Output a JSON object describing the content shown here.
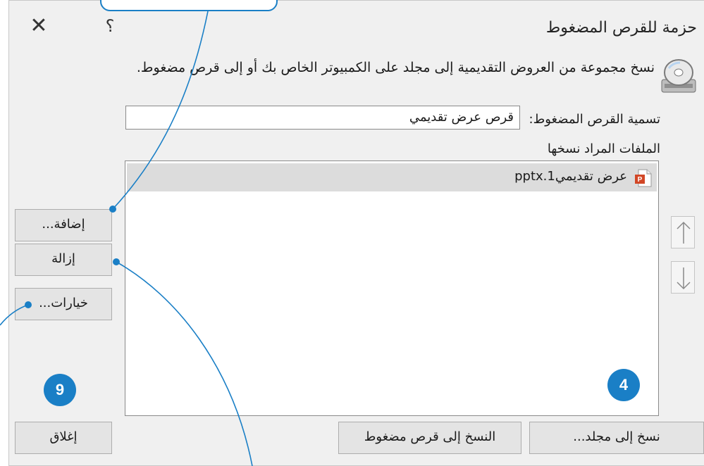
{
  "window": {
    "title": "حزمة للقرص المضغوط",
    "close_symbol": "✕",
    "help_symbol": "؟"
  },
  "description": "نسخ مجموعة من العروض التقديمية إلى مجلد على الكمبيوتر الخاص بك أو إلى قرص مضغوط.",
  "cd_name": {
    "label": "تسمية القرص المضغوط:",
    "value": "قرص عرض تقديمي"
  },
  "files": {
    "label": "الملفات المراد نسخها",
    "items": [
      {
        "name": "عرض تقديمي1.pptx",
        "icon": "powerpoint-file-icon"
      }
    ]
  },
  "buttons": {
    "add": "إضافة...",
    "remove": "إزالة",
    "options": "خيارات...",
    "close": "إغلاق",
    "copy_to_cd": "النسخ إلى قرص مضغوط",
    "copy_to_folder": "نسخ إلى مجلد..."
  },
  "reorder": {
    "up_icon": "arrow-up-icon",
    "down_icon": "arrow-down-icon"
  },
  "badges": {
    "close_step": "9",
    "copy_folder_step": "4"
  },
  "colors": {
    "accent": "#1a7fc6",
    "dialog_bg": "#f0f0f0",
    "selected_row": "#dcdcdc"
  }
}
